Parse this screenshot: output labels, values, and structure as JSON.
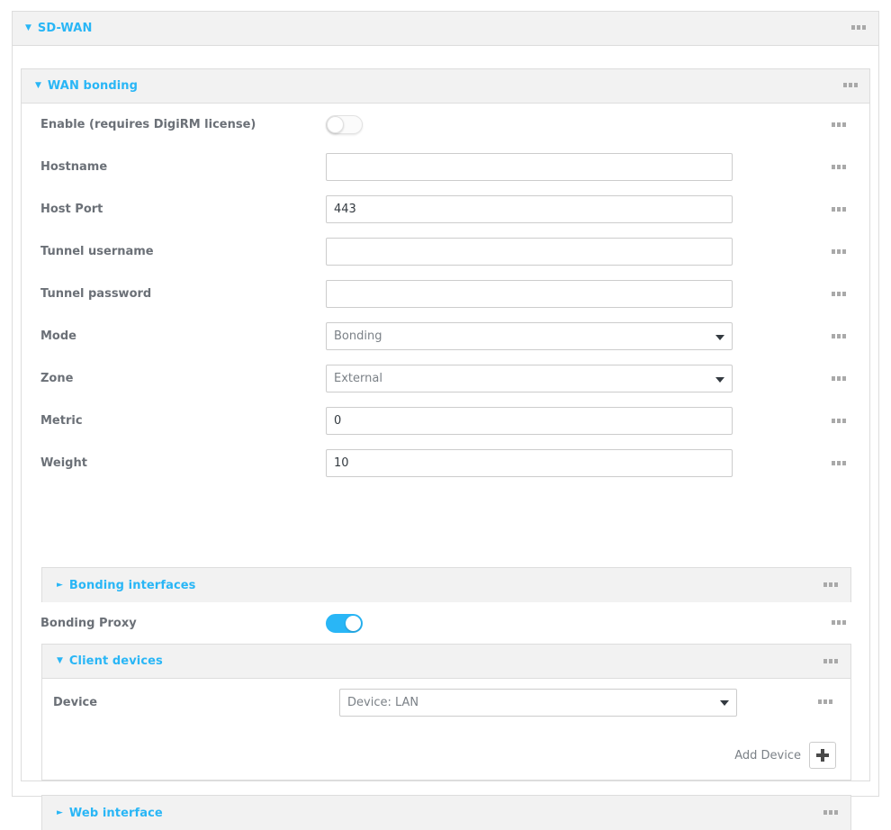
{
  "sdwan": {
    "title": "SD-WAN",
    "caret": "▼",
    "menu_icon": "kebab-menu-icon"
  },
  "wan_bonding": {
    "title": "WAN bonding",
    "caret": "▼",
    "fields": {
      "enable": {
        "label": "Enable (requires DigiRM license)",
        "state": "off"
      },
      "hostname": {
        "label": "Hostname",
        "value": "",
        "placeholder": ""
      },
      "host_port": {
        "label": "Host Port",
        "value": "443",
        "placeholder": ""
      },
      "tunnel_username": {
        "label": "Tunnel username",
        "value": "",
        "placeholder": ""
      },
      "tunnel_password": {
        "label": "Tunnel password",
        "value": "",
        "placeholder": ""
      },
      "mode": {
        "label": "Mode",
        "value": "Bonding",
        "options": [
          "Bonding"
        ]
      },
      "zone": {
        "label": "Zone",
        "value": "External",
        "options": [
          "External"
        ]
      },
      "metric": {
        "label": "Metric",
        "value": "0",
        "placeholder": ""
      },
      "weight": {
        "label": "Weight",
        "value": "10",
        "placeholder": ""
      },
      "bonding_proxy": {
        "label": "Bonding Proxy",
        "state": "on"
      }
    },
    "bonding_interfaces": {
      "title": "Bonding interfaces",
      "caret": "►"
    },
    "client_devices": {
      "title": "Client devices",
      "caret": "▼",
      "device": {
        "label": "Device",
        "value": "Device: LAN",
        "options": [
          "Device: LAN"
        ]
      },
      "add_device_label": "Add Device",
      "add_device_icon": "plus-icon"
    },
    "web_interface": {
      "title": "Web interface",
      "caret": "►"
    }
  },
  "colors": {
    "accent": "#29b6f6",
    "label_text": "#6b7077",
    "panel_head_bg": "#f2f2f2",
    "border": "#dddddd"
  }
}
